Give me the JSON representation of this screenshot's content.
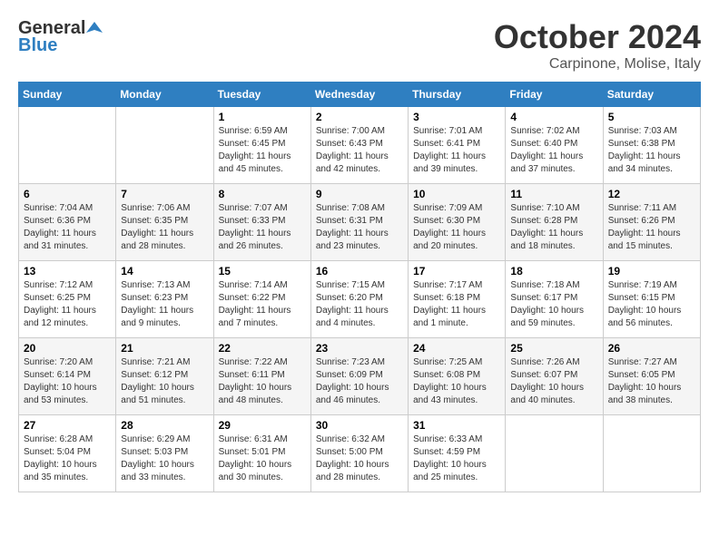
{
  "header": {
    "logo_general": "General",
    "logo_blue": "Blue",
    "month": "October 2024",
    "location": "Carpinone, Molise, Italy"
  },
  "weekdays": [
    "Sunday",
    "Monday",
    "Tuesday",
    "Wednesday",
    "Thursday",
    "Friday",
    "Saturday"
  ],
  "weeks": [
    [
      {
        "day": "",
        "sunrise": "",
        "sunset": "",
        "daylight": ""
      },
      {
        "day": "",
        "sunrise": "",
        "sunset": "",
        "daylight": ""
      },
      {
        "day": "1",
        "sunrise": "Sunrise: 6:59 AM",
        "sunset": "Sunset: 6:45 PM",
        "daylight": "Daylight: 11 hours and 45 minutes."
      },
      {
        "day": "2",
        "sunrise": "Sunrise: 7:00 AM",
        "sunset": "Sunset: 6:43 PM",
        "daylight": "Daylight: 11 hours and 42 minutes."
      },
      {
        "day": "3",
        "sunrise": "Sunrise: 7:01 AM",
        "sunset": "Sunset: 6:41 PM",
        "daylight": "Daylight: 11 hours and 39 minutes."
      },
      {
        "day": "4",
        "sunrise": "Sunrise: 7:02 AM",
        "sunset": "Sunset: 6:40 PM",
        "daylight": "Daylight: 11 hours and 37 minutes."
      },
      {
        "day": "5",
        "sunrise": "Sunrise: 7:03 AM",
        "sunset": "Sunset: 6:38 PM",
        "daylight": "Daylight: 11 hours and 34 minutes."
      }
    ],
    [
      {
        "day": "6",
        "sunrise": "Sunrise: 7:04 AM",
        "sunset": "Sunset: 6:36 PM",
        "daylight": "Daylight: 11 hours and 31 minutes."
      },
      {
        "day": "7",
        "sunrise": "Sunrise: 7:06 AM",
        "sunset": "Sunset: 6:35 PM",
        "daylight": "Daylight: 11 hours and 28 minutes."
      },
      {
        "day": "8",
        "sunrise": "Sunrise: 7:07 AM",
        "sunset": "Sunset: 6:33 PM",
        "daylight": "Daylight: 11 hours and 26 minutes."
      },
      {
        "day": "9",
        "sunrise": "Sunrise: 7:08 AM",
        "sunset": "Sunset: 6:31 PM",
        "daylight": "Daylight: 11 hours and 23 minutes."
      },
      {
        "day": "10",
        "sunrise": "Sunrise: 7:09 AM",
        "sunset": "Sunset: 6:30 PM",
        "daylight": "Daylight: 11 hours and 20 minutes."
      },
      {
        "day": "11",
        "sunrise": "Sunrise: 7:10 AM",
        "sunset": "Sunset: 6:28 PM",
        "daylight": "Daylight: 11 hours and 18 minutes."
      },
      {
        "day": "12",
        "sunrise": "Sunrise: 7:11 AM",
        "sunset": "Sunset: 6:26 PM",
        "daylight": "Daylight: 11 hours and 15 minutes."
      }
    ],
    [
      {
        "day": "13",
        "sunrise": "Sunrise: 7:12 AM",
        "sunset": "Sunset: 6:25 PM",
        "daylight": "Daylight: 11 hours and 12 minutes."
      },
      {
        "day": "14",
        "sunrise": "Sunrise: 7:13 AM",
        "sunset": "Sunset: 6:23 PM",
        "daylight": "Daylight: 11 hours and 9 minutes."
      },
      {
        "day": "15",
        "sunrise": "Sunrise: 7:14 AM",
        "sunset": "Sunset: 6:22 PM",
        "daylight": "Daylight: 11 hours and 7 minutes."
      },
      {
        "day": "16",
        "sunrise": "Sunrise: 7:15 AM",
        "sunset": "Sunset: 6:20 PM",
        "daylight": "Daylight: 11 hours and 4 minutes."
      },
      {
        "day": "17",
        "sunrise": "Sunrise: 7:17 AM",
        "sunset": "Sunset: 6:18 PM",
        "daylight": "Daylight: 11 hours and 1 minute."
      },
      {
        "day": "18",
        "sunrise": "Sunrise: 7:18 AM",
        "sunset": "Sunset: 6:17 PM",
        "daylight": "Daylight: 10 hours and 59 minutes."
      },
      {
        "day": "19",
        "sunrise": "Sunrise: 7:19 AM",
        "sunset": "Sunset: 6:15 PM",
        "daylight": "Daylight: 10 hours and 56 minutes."
      }
    ],
    [
      {
        "day": "20",
        "sunrise": "Sunrise: 7:20 AM",
        "sunset": "Sunset: 6:14 PM",
        "daylight": "Daylight: 10 hours and 53 minutes."
      },
      {
        "day": "21",
        "sunrise": "Sunrise: 7:21 AM",
        "sunset": "Sunset: 6:12 PM",
        "daylight": "Daylight: 10 hours and 51 minutes."
      },
      {
        "day": "22",
        "sunrise": "Sunrise: 7:22 AM",
        "sunset": "Sunset: 6:11 PM",
        "daylight": "Daylight: 10 hours and 48 minutes."
      },
      {
        "day": "23",
        "sunrise": "Sunrise: 7:23 AM",
        "sunset": "Sunset: 6:09 PM",
        "daylight": "Daylight: 10 hours and 46 minutes."
      },
      {
        "day": "24",
        "sunrise": "Sunrise: 7:25 AM",
        "sunset": "Sunset: 6:08 PM",
        "daylight": "Daylight: 10 hours and 43 minutes."
      },
      {
        "day": "25",
        "sunrise": "Sunrise: 7:26 AM",
        "sunset": "Sunset: 6:07 PM",
        "daylight": "Daylight: 10 hours and 40 minutes."
      },
      {
        "day": "26",
        "sunrise": "Sunrise: 7:27 AM",
        "sunset": "Sunset: 6:05 PM",
        "daylight": "Daylight: 10 hours and 38 minutes."
      }
    ],
    [
      {
        "day": "27",
        "sunrise": "Sunrise: 6:28 AM",
        "sunset": "Sunset: 5:04 PM",
        "daylight": "Daylight: 10 hours and 35 minutes."
      },
      {
        "day": "28",
        "sunrise": "Sunrise: 6:29 AM",
        "sunset": "Sunset: 5:03 PM",
        "daylight": "Daylight: 10 hours and 33 minutes."
      },
      {
        "day": "29",
        "sunrise": "Sunrise: 6:31 AM",
        "sunset": "Sunset: 5:01 PM",
        "daylight": "Daylight: 10 hours and 30 minutes."
      },
      {
        "day": "30",
        "sunrise": "Sunrise: 6:32 AM",
        "sunset": "Sunset: 5:00 PM",
        "daylight": "Daylight: 10 hours and 28 minutes."
      },
      {
        "day": "31",
        "sunrise": "Sunrise: 6:33 AM",
        "sunset": "Sunset: 4:59 PM",
        "daylight": "Daylight: 10 hours and 25 minutes."
      },
      {
        "day": "",
        "sunrise": "",
        "sunset": "",
        "daylight": ""
      },
      {
        "day": "",
        "sunrise": "",
        "sunset": "",
        "daylight": ""
      }
    ]
  ]
}
